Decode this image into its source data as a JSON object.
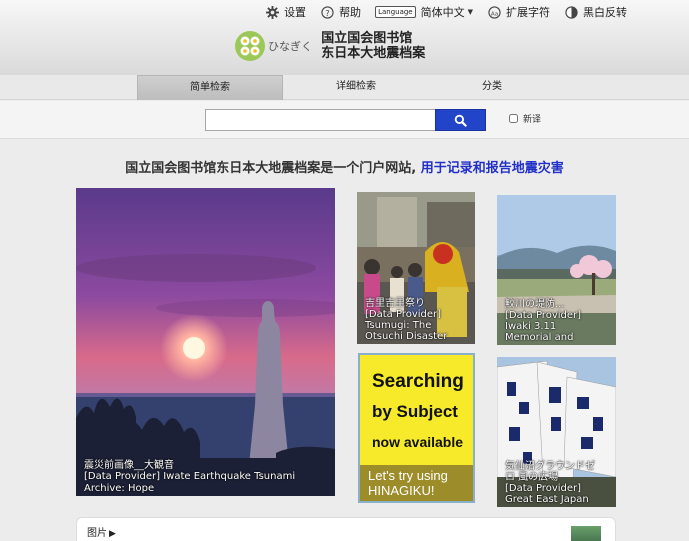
{
  "toolbar": {
    "settings": "设置",
    "help": "帮助",
    "language_badge": "Language",
    "language": "简体中文",
    "ext_chars": "扩展字符",
    "contrast": "黑白反转"
  },
  "logo": {
    "kana": "ひなぎく",
    "line1": "国立国会图书馆",
    "line2": "东日本大地震档案"
  },
  "tabs": [
    {
      "label": "简单检索",
      "active": true
    },
    {
      "label": "详细检索",
      "active": false
    },
    {
      "label": "分类",
      "active": false
    }
  ],
  "search": {
    "value": "",
    "placeholder": "",
    "new_label": "新译"
  },
  "headline": {
    "main": "国立国会图书馆东日本大地震档案是一个门户网站,",
    "accent": "用于记录和报告地震灾害"
  },
  "cards": {
    "main": {
      "title": "震災前画像__大観音",
      "provider": "[Data Provider] Iwate Earthquake Tsunami",
      "source": "Archive: Hope"
    },
    "festival": {
      "title": "吉里吉里祭り",
      "provider": "[Data Provider]",
      "source1": "Tsumugi: The",
      "source2": "Otsuchi Disaster"
    },
    "river": {
      "title": "鮫川の堤防...",
      "provider": "[Data Provider]",
      "source1": "Iwaki 3.11",
      "source2": "Memorial and"
    },
    "flags": {
      "title1": "気仙沼グラウンドゼ",
      "title2": "ロ 風の広場",
      "provider": "[Data Provider]",
      "source": "Great East Japan"
    }
  },
  "promo": {
    "line1": "Searching",
    "line2": "by Subject",
    "line3": "now available",
    "foot1": "Let's try using",
    "foot2": "HINAGIKU!"
  },
  "bottom": {
    "label": "图片"
  },
  "colors": {
    "accent": "#2230c8",
    "search_button": "#2244c8",
    "promo_yellow": "#f6ea2a"
  }
}
